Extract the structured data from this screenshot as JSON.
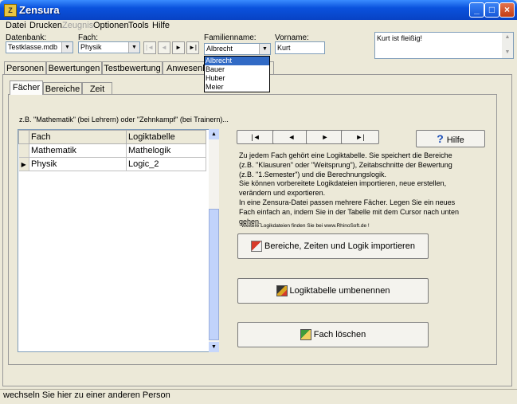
{
  "window": {
    "title": "Zensura",
    "icon_letter": "Z"
  },
  "title_buttons": {
    "minimize": "_",
    "maximize": "□",
    "close": "×"
  },
  "menu": [
    "Datei",
    "Drucken",
    "Zeugnis",
    "Optionen",
    "Tools",
    "Hilfe"
  ],
  "toolbar": {
    "datenbank_label": "Datenbank:",
    "datenbank_value": "Testklasse.mdb",
    "fach_label": "Fach:",
    "fach_value": "Physik",
    "familienname_label": "Familienname:",
    "familienname_value": "Albrecht",
    "vorname_label": "Vorname:",
    "vorname_value": "Kurt",
    "memo_text": "Kurt ist fleißig!",
    "nav": [
      "|◄",
      "◄",
      "►",
      "►|"
    ]
  },
  "name_dropdown": {
    "items": [
      "Albrecht",
      "Bauer",
      "Huber",
      "Meier"
    ],
    "selected": "Albrecht"
  },
  "outer_tabs": [
    "Personen",
    "Bewertungen",
    "Testbewertung",
    "Anwesenheit"
  ],
  "inner_tabs": [
    "Fächer",
    "Bereiche",
    "Zeit"
  ],
  "hint": "z.B. \"Mathematik\" (bei Lehrern) oder \"Zehnkampf\" (bei Trainern)...",
  "grid": {
    "columns": [
      "Fach",
      "Logiktabelle"
    ],
    "rows": [
      {
        "fach": "Mathematik",
        "logik": "Mathelogik",
        "current": false
      },
      {
        "fach": "Physik",
        "logik": "Logic_2",
        "current": true
      }
    ],
    "current_marker": "▶"
  },
  "panel_nav": [
    "|◄",
    "◄",
    "►",
    "►|"
  ],
  "help_button": {
    "icon": "?",
    "label": "Hilfe"
  },
  "info_lines": [
    "Zu jedem Fach gehört eine Logiktabelle. Sie speichert die Bereiche",
    "(z.B. \"Klausuren\" oder \"Weitsprung\"), Zeitabschnitte der Bewertung",
    "(z.B. \"1.Semester\") und die Berechnungslogik.",
    "Sie können vorbereitete Logikdateien importieren, neue erstellen,",
    "verändern und exportieren.",
    "In eine Zensura-Datei passen mehrere Fächer. Legen Sie ein neues",
    "Fach einfach an, indem Sie in der Tabelle mit dem Cursor nach unten gehen."
  ],
  "weblink": "Weitere Logikdateien finden Sie bei www.RhinoSoft.de  !",
  "buttons": {
    "import": "Bereiche, Zeiten und Logik importieren",
    "rename": "Logiktabelle umbenennen",
    "delete": "Fach löschen"
  },
  "scroll_arrows": {
    "up": "▲",
    "down": "▼"
  },
  "dropdown_arrow": "▼",
  "status": "wechseln Sie hier zu einer anderen Person",
  "colors": {
    "titlebar": "#0a52dd",
    "selection": "#316ac5",
    "face": "#ece9d8"
  }
}
